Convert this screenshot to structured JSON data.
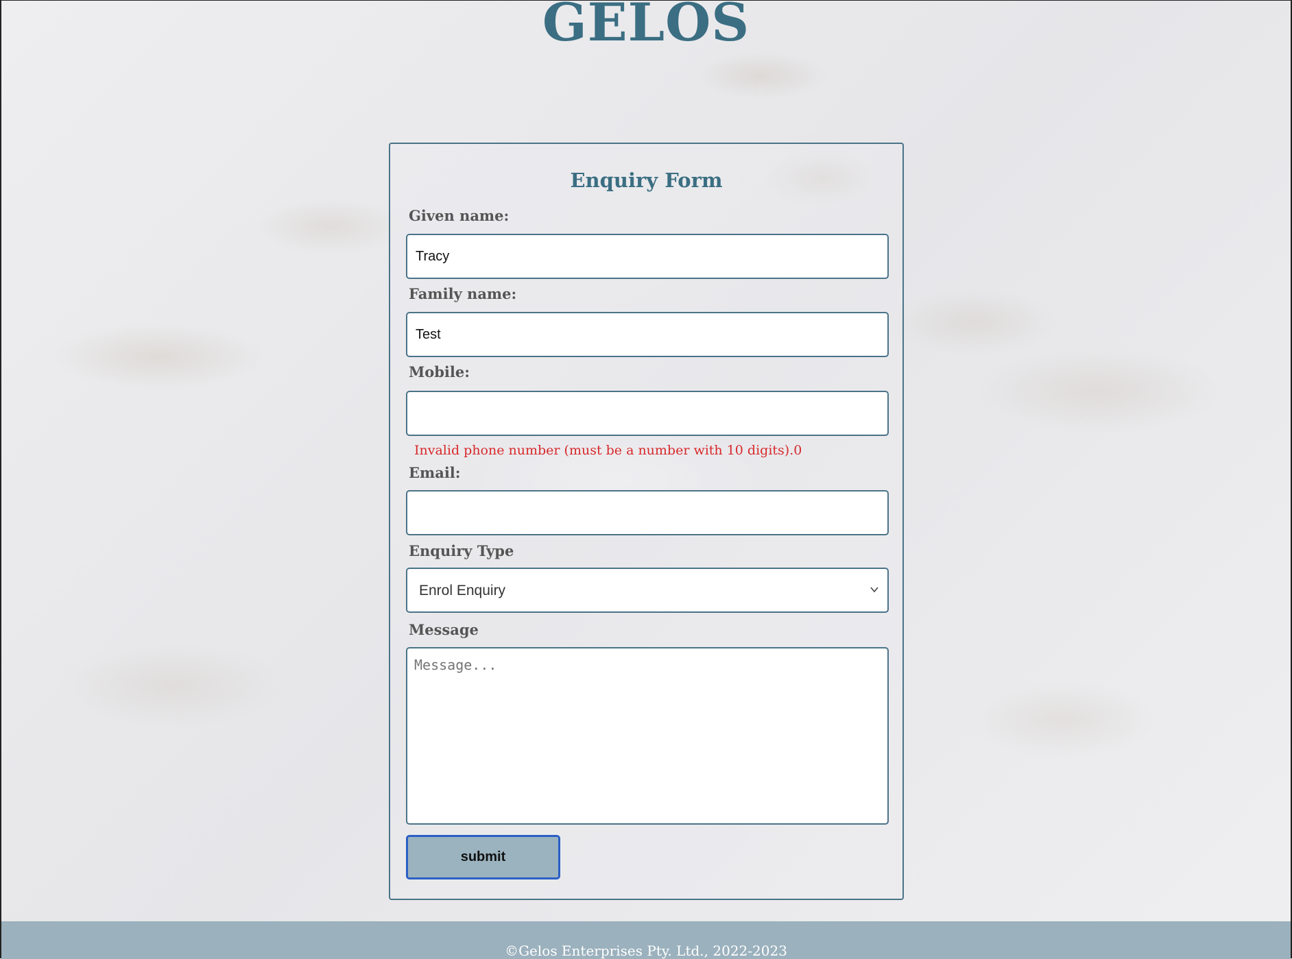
{
  "site": {
    "title": "GELOS"
  },
  "form": {
    "heading": "Enquiry Form",
    "given_name": {
      "label": "Given name:",
      "value": "Tracy"
    },
    "family_name": {
      "label": "Family name:",
      "value": "Test"
    },
    "mobile": {
      "label": "Mobile:",
      "value": "",
      "error": "Invalid phone number (must be a number with 10 digits).0"
    },
    "email": {
      "label": "Email:",
      "value": ""
    },
    "enquiry_type": {
      "label": "Enquiry Type",
      "selected": "Enrol Enquiry"
    },
    "message": {
      "label": "Message",
      "placeholder": "Message..."
    },
    "submit_label": "submit"
  },
  "footer": {
    "text": "©Gelos Enterprises Pty. Ltd., 2022-2023"
  },
  "colors": {
    "accent": "#3b6e82",
    "border": "#4a7388",
    "error": "#d8282a",
    "button_bg": "#9ab3bf",
    "button_focus": "#2a5fc5",
    "footer_bg": "#9bb1bd"
  },
  "icons": {
    "select_indicator": "chevron-down-icon"
  }
}
